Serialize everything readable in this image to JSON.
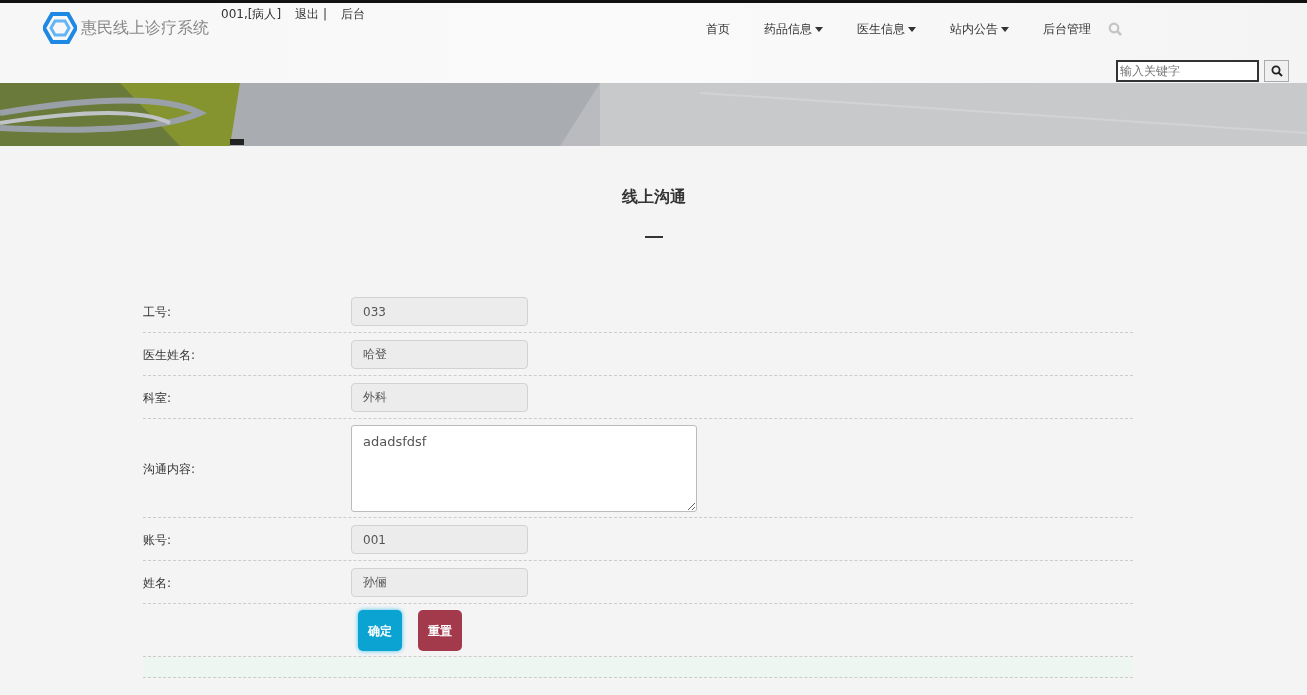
{
  "header": {
    "site_name": "惠民线上诊疗系统",
    "user_links": [
      "001,[病人]",
      "退出 |",
      "后台"
    ],
    "nav": [
      {
        "label": "首页",
        "dropdown": false
      },
      {
        "label": "药品信息",
        "dropdown": true
      },
      {
        "label": "医生信息",
        "dropdown": true
      },
      {
        "label": "站内公告",
        "dropdown": true
      },
      {
        "label": "后台管理",
        "dropdown": false
      }
    ],
    "search": {
      "placeholder": "输入关键字"
    }
  },
  "title": "线上沟通",
  "form": {
    "rows": [
      {
        "label": "工号:",
        "kind": "input",
        "value": "033",
        "readonly": true
      },
      {
        "label": "医生姓名:",
        "kind": "input",
        "value": "哈登",
        "readonly": true
      },
      {
        "label": "科室:",
        "kind": "input",
        "value": "外科",
        "readonly": true
      },
      {
        "label": "沟通内容:",
        "kind": "textarea",
        "value": "adadsfdsf",
        "readonly": false
      },
      {
        "label": "账号:",
        "kind": "input",
        "value": "001",
        "readonly": true
      },
      {
        "label": "姓名:",
        "kind": "input",
        "value": "孙俪",
        "readonly": true
      }
    ],
    "buttons": [
      {
        "label": "确定",
        "kind": "submit"
      },
      {
        "label": "重置",
        "kind": "reset"
      }
    ]
  }
}
